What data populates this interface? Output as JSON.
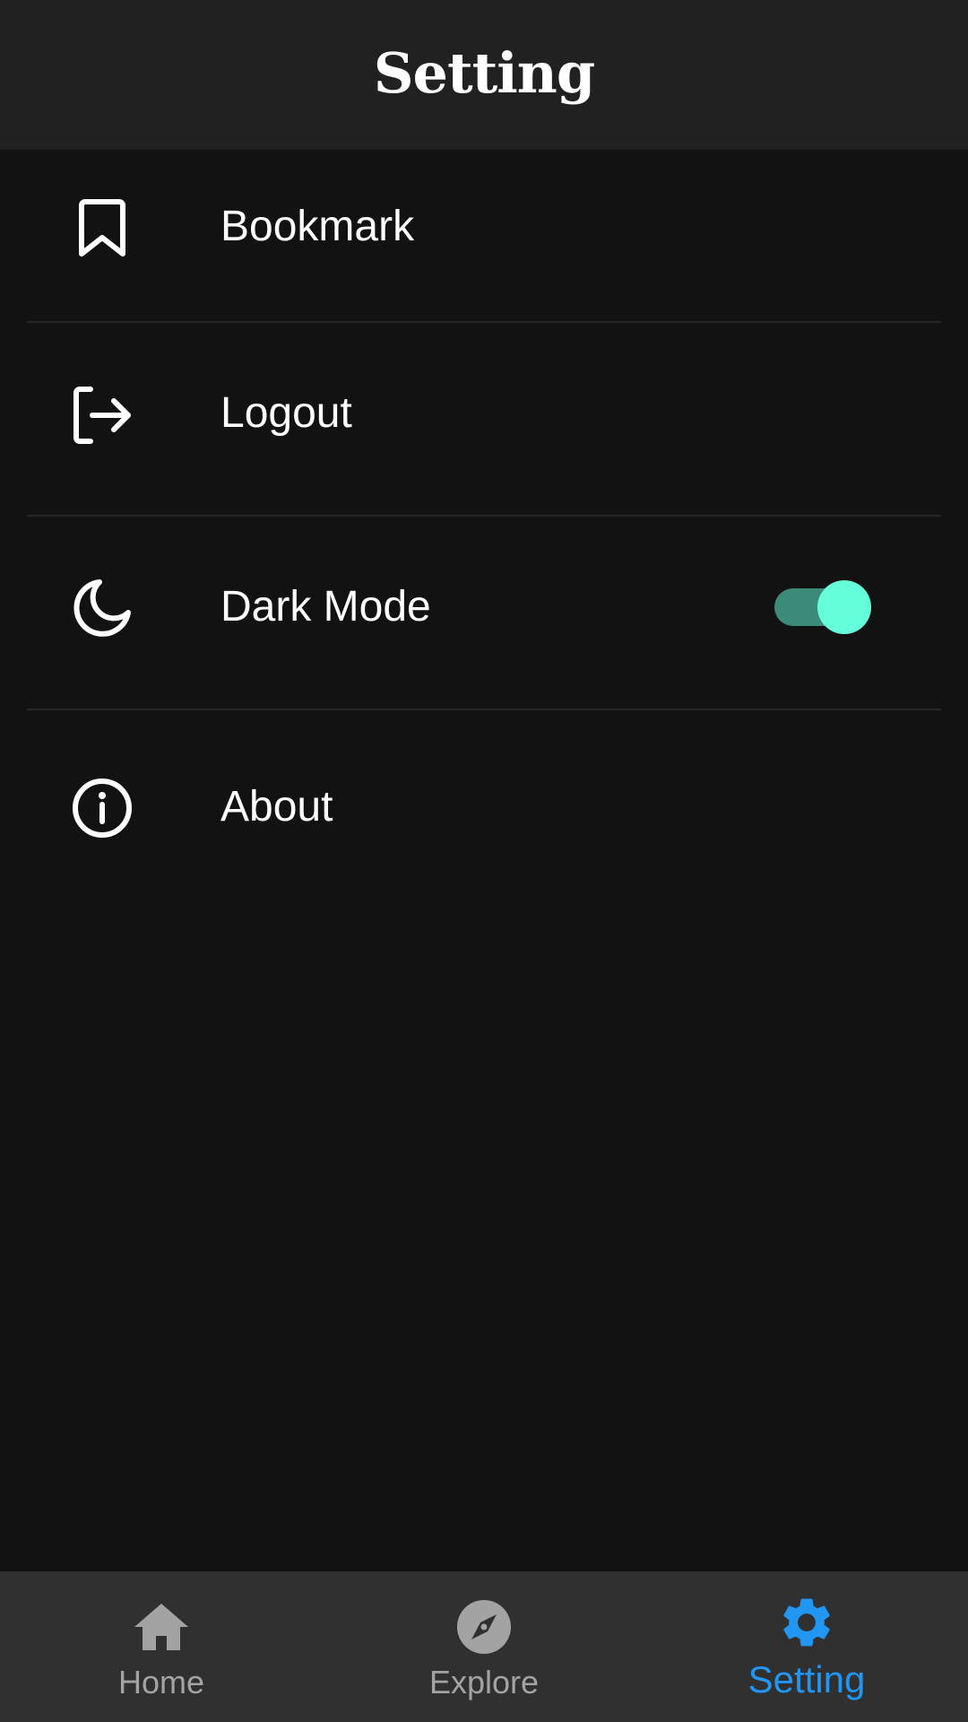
{
  "app_bar": {
    "title": "Setting"
  },
  "settings": {
    "items": [
      {
        "label": "Bookmark",
        "icon": "bookmark-icon"
      },
      {
        "label": "Logout",
        "icon": "logout-icon"
      },
      {
        "label": "Dark Mode",
        "icon": "moon-icon",
        "toggle_on": true
      },
      {
        "label": "About",
        "icon": "info-icon"
      }
    ]
  },
  "bottom_nav": {
    "items": [
      {
        "label": "Home",
        "icon": "home-icon",
        "active": false
      },
      {
        "label": "Explore",
        "icon": "compass-icon",
        "active": false
      },
      {
        "label": "Setting",
        "icon": "gear-icon",
        "active": true
      }
    ]
  },
  "colors": {
    "background": "#121212",
    "app_bar": "#212121",
    "bottom_nav": "#303030",
    "active_tab": "#2196f3",
    "inactive_tab": "#a3a3a3",
    "toggle_thumb": "#64ffda",
    "toggle_track": "#3b8b78"
  }
}
